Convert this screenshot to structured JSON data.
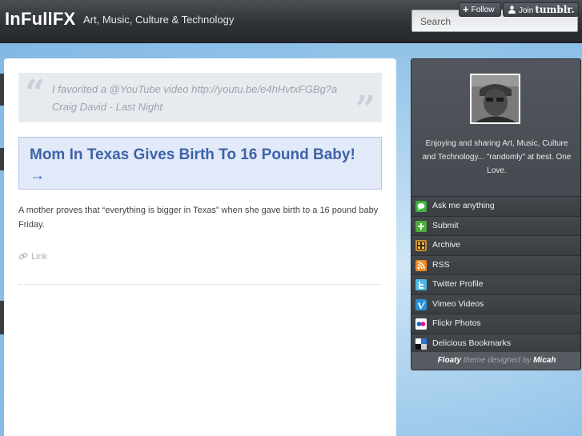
{
  "header": {
    "site_title": "InFullFX",
    "tagline": "Art, Music, Culture & Technology",
    "search_label": "Search"
  },
  "tumblr_controls": {
    "follow_label": "Follow",
    "join_label": "Join",
    "brand": "tumblr."
  },
  "post": {
    "quote": "I favorited a @YouTube video http://youtu.be/e4hHvtxFGBg?a Craig David - Last Night",
    "link_title": "Mom In Texas Gives Birth To 16 Pound Baby! →",
    "body": "A mother proves that “everything is bigger in Texas” when she gave birth to a 16 pound baby Friday.",
    "link_label": "Link"
  },
  "sidebar": {
    "bio": "Enjoying and sharing Art, Music, Culture and Technology... \"randomly\" at best. One Love.",
    "items": [
      {
        "label": "Ask me anything",
        "icon": "chat-bubble-icon",
        "color": "#3cb13c"
      },
      {
        "label": "Submit",
        "icon": "plus-icon",
        "color": "#4caf3c"
      },
      {
        "label": "Archive",
        "icon": "archive-grid-icon",
        "color": "#c8902c"
      },
      {
        "label": "RSS",
        "icon": "rss-icon",
        "color": "#f08a24"
      },
      {
        "label": "Twitter Profile",
        "icon": "twitter-icon",
        "color": "#4fb8e8"
      },
      {
        "label": "Vimeo Videos",
        "icon": "vimeo-icon",
        "color": "#2a8fd6"
      },
      {
        "label": "Flickr Photos",
        "icon": "flickr-icon",
        "color": "#ffffff"
      },
      {
        "label": "Delicious Bookmarks",
        "icon": "delicious-icon",
        "color": "#3274d1"
      }
    ],
    "footer": {
      "theme": "Floaty",
      "middle": "theme designed by",
      "author": "Micah"
    }
  }
}
